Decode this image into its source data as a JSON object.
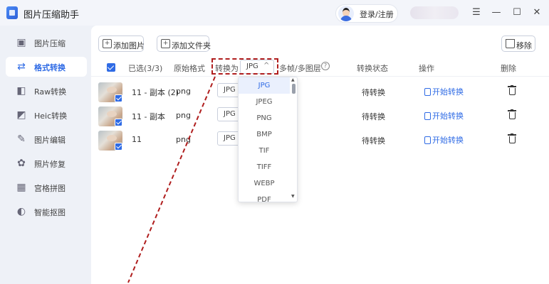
{
  "app": {
    "title": "图片压缩助手",
    "login_label": "登录/注册",
    "window_controls": [
      "☰",
      "—",
      "☐",
      "✕"
    ]
  },
  "sidebar": {
    "items": [
      {
        "label": "图片压缩",
        "icon": "image-icon",
        "glyph": "▣",
        "active": false
      },
      {
        "label": "格式转换",
        "icon": "convert-icon",
        "glyph": "⇄",
        "active": true
      },
      {
        "label": "Raw转换",
        "icon": "raw-icon",
        "glyph": "◧",
        "active": false
      },
      {
        "label": "Heic转换",
        "icon": "heic-icon",
        "glyph": "◩",
        "active": false
      },
      {
        "label": "图片编辑",
        "icon": "edit-icon",
        "glyph": "✎",
        "active": false
      },
      {
        "label": "照片修复",
        "icon": "repair-icon",
        "glyph": "✿",
        "active": false
      },
      {
        "label": "宫格拼图",
        "icon": "grid-icon",
        "glyph": "▦",
        "active": false
      },
      {
        "label": "智能抠图",
        "icon": "cutout-icon",
        "glyph": "◐",
        "active": false
      }
    ]
  },
  "toolbar": {
    "add_image": "添加图片",
    "add_folder": "添加文件夹",
    "remove": "移除"
  },
  "table": {
    "headers": {
      "selected": "已选(3/3)",
      "original_format": "原始格式",
      "convert_to": "转换为",
      "convert_to_value": "JPG",
      "multi_frame": "多帧/多图层",
      "status": "转换状态",
      "action": "操作",
      "delete": "删除"
    },
    "rows": [
      {
        "name": "11 - 副本 (2)",
        "format": "png",
        "target": "JPG",
        "status": "待转换",
        "action": "开始转换"
      },
      {
        "name": "11 - 副本",
        "format": "png",
        "target": "JPG",
        "status": "待转换",
        "action": "开始转换"
      },
      {
        "name": "11",
        "format": "png",
        "target": "JPG",
        "status": "待转换",
        "action": "开始转换"
      }
    ]
  },
  "format_dropdown": {
    "options": [
      "JPG",
      "JPEG",
      "PNG",
      "BMP",
      "TIF",
      "TIFF",
      "WEBP",
      "PDF"
    ],
    "selected": "JPG"
  },
  "colors": {
    "accent": "#2f6be5",
    "annotation": "#b01e1e",
    "sidebar_bg": "#eef1f7"
  }
}
